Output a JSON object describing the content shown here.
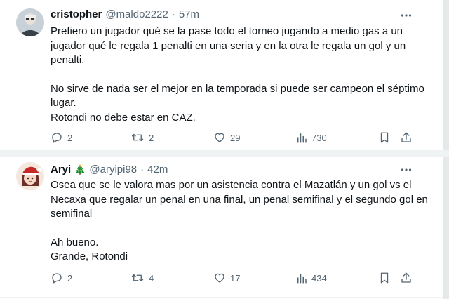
{
  "tweets": [
    {
      "name": "cristopher",
      "badge": "",
      "handle": "@maldo2222",
      "separator": "·",
      "time": "57m",
      "lines": [
        "Prefiero un jugador qué se la pase todo el torneo jugando a medio gas a un jugador qué le regala 1 penalti en una seria y en la otra le regala un gol y un penalti.",
        "",
        "No sirve de nada ser el mejor en la temporada si puede ser campeon el séptimo lugar.",
        "Rotondi no debe estar en CAZ."
      ],
      "replies": "2",
      "retweets": "2",
      "likes": "29",
      "views": "730"
    },
    {
      "name": "Aryi",
      "badge": "🎄",
      "handle": "@aryipi98",
      "separator": "·",
      "time": "42m",
      "lines": [
        "Osea que se le valora mas por un asistencia contra el Mazatlán y un gol vs el Necaxa que regalar un penal en una final, un penal semifinal y el segundo gol en semifinal",
        "",
        "Ah bueno.",
        "Grande, Rotondi"
      ],
      "replies": "2",
      "retweets": "4",
      "likes": "17",
      "views": "434"
    }
  ],
  "icons": [
    "reply-icon",
    "retweet-icon",
    "like-icon",
    "views-icon",
    "bookmark-icon",
    "share-icon",
    "more-icon"
  ],
  "colors": {
    "text": "#0f1419",
    "secondary": "#536471",
    "divider": "#eff3f4",
    "tree": "#2e7d32"
  }
}
